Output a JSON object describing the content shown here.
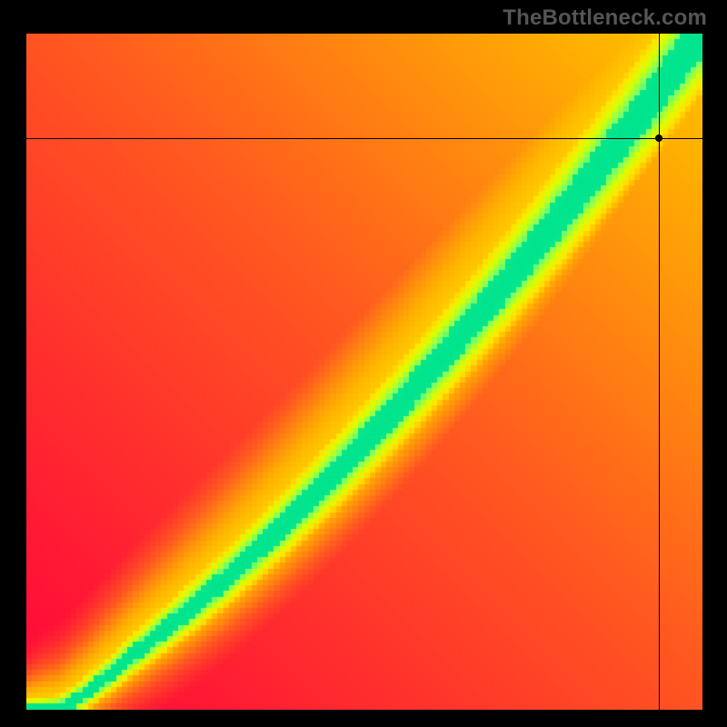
{
  "watermark": "TheBottleneck.com",
  "chart_data": {
    "type": "heatmap",
    "title": "",
    "xlabel": "",
    "ylabel": "",
    "xlim": [
      0,
      1
    ],
    "ylim": [
      0,
      1
    ],
    "pixelated_grid": 120,
    "score_model": {
      "description": "color = f(distance from optimal curve); green on curve, yellow near, red/orange far; slight top-right bias toward green/yellow",
      "curve": "y ≈ x^1.35 with mild S-shape; green band widens toward top-right",
      "band_halfwidth_at_x0": 0.015,
      "band_halfwidth_at_x1": 0.1
    },
    "colormap_stops": [
      {
        "t": 0.0,
        "hex": "#ff073a"
      },
      {
        "t": 0.25,
        "hex": "#ff5a1f"
      },
      {
        "t": 0.45,
        "hex": "#ffb400"
      },
      {
        "t": 0.6,
        "hex": "#ffe600"
      },
      {
        "t": 0.75,
        "hex": "#d6ff00"
      },
      {
        "t": 0.88,
        "hex": "#7dff66"
      },
      {
        "t": 1.0,
        "hex": "#00e48e"
      }
    ],
    "crosshair": {
      "x": 0.935,
      "y": 0.845,
      "marker_radius_px": 4
    },
    "grid": false,
    "legend": false
  }
}
